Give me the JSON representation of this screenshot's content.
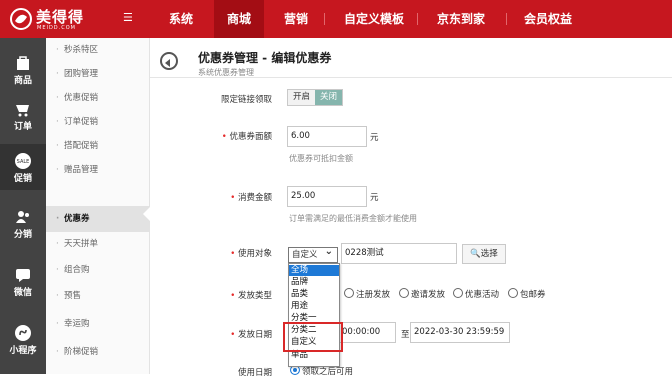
{
  "brand": {
    "name": "美得得",
    "domain": "MEIDD.COM"
  },
  "top_nav": [
    "系统",
    "商城",
    "营销",
    "自定义模板",
    "京东到家",
    "会员权益"
  ],
  "top_nav_active": "商城",
  "sidebar": [
    {
      "label": "商品",
      "icon": "bag-icon"
    },
    {
      "label": "订单",
      "icon": "cart-icon"
    },
    {
      "label": "促销",
      "icon": "sale-icon",
      "active": true
    },
    {
      "label": "分销",
      "icon": "people-icon"
    },
    {
      "label": "微信",
      "icon": "chat-icon"
    },
    {
      "label": "小程序",
      "icon": "mini-program-icon"
    }
  ],
  "subnav": [
    "秒杀特区",
    "团购管理",
    "优惠促销",
    "订单促销",
    "搭配促销",
    "赠品管理",
    "优惠券",
    "天天拼单",
    "组合购",
    "预售",
    "幸运购",
    "阶梯促销"
  ],
  "subnav_active": "优惠券",
  "page": {
    "title": "优惠券管理 - 编辑优惠券",
    "subtitle": "系统优惠券管理"
  },
  "form": {
    "limit_link": {
      "label": "限定链接领取",
      "options": [
        "开启",
        "关闭"
      ],
      "selected": "关闭"
    },
    "face_value": {
      "label": "优惠券面额",
      "value": "6.00",
      "unit": "元",
      "hint": "优惠券可抵扣金额"
    },
    "min_spend": {
      "label": "消费金额",
      "value": "25.00",
      "unit": "元",
      "hint": "订单需满足的最低消费金额才能使用"
    },
    "target": {
      "label": "使用对象",
      "select_value": "自定义",
      "input_value": "0228测试",
      "button": "选择",
      "dropdown": [
        "全场",
        "品牌",
        "品类",
        "用途",
        "分类一",
        "分类二",
        "自定义",
        "单品"
      ],
      "highlighted": "全场"
    },
    "issue_type": {
      "label": "发放类型",
      "options": [
        "注册发放",
        "邀请发放",
        "优惠活动",
        "包邮券"
      ]
    },
    "issue_date": {
      "label": "发放日期",
      "start_fragment": "00:00:00",
      "to": "至",
      "end": "2022-03-30 23:59:59"
    },
    "use_date": {
      "label": "使用日期",
      "option": "领取之后可用"
    }
  },
  "colors": {
    "brand_red": "#c6171f",
    "sidebar": "#434343",
    "select_highlight": "#1e79d6",
    "annotation_box": "#d92828"
  }
}
